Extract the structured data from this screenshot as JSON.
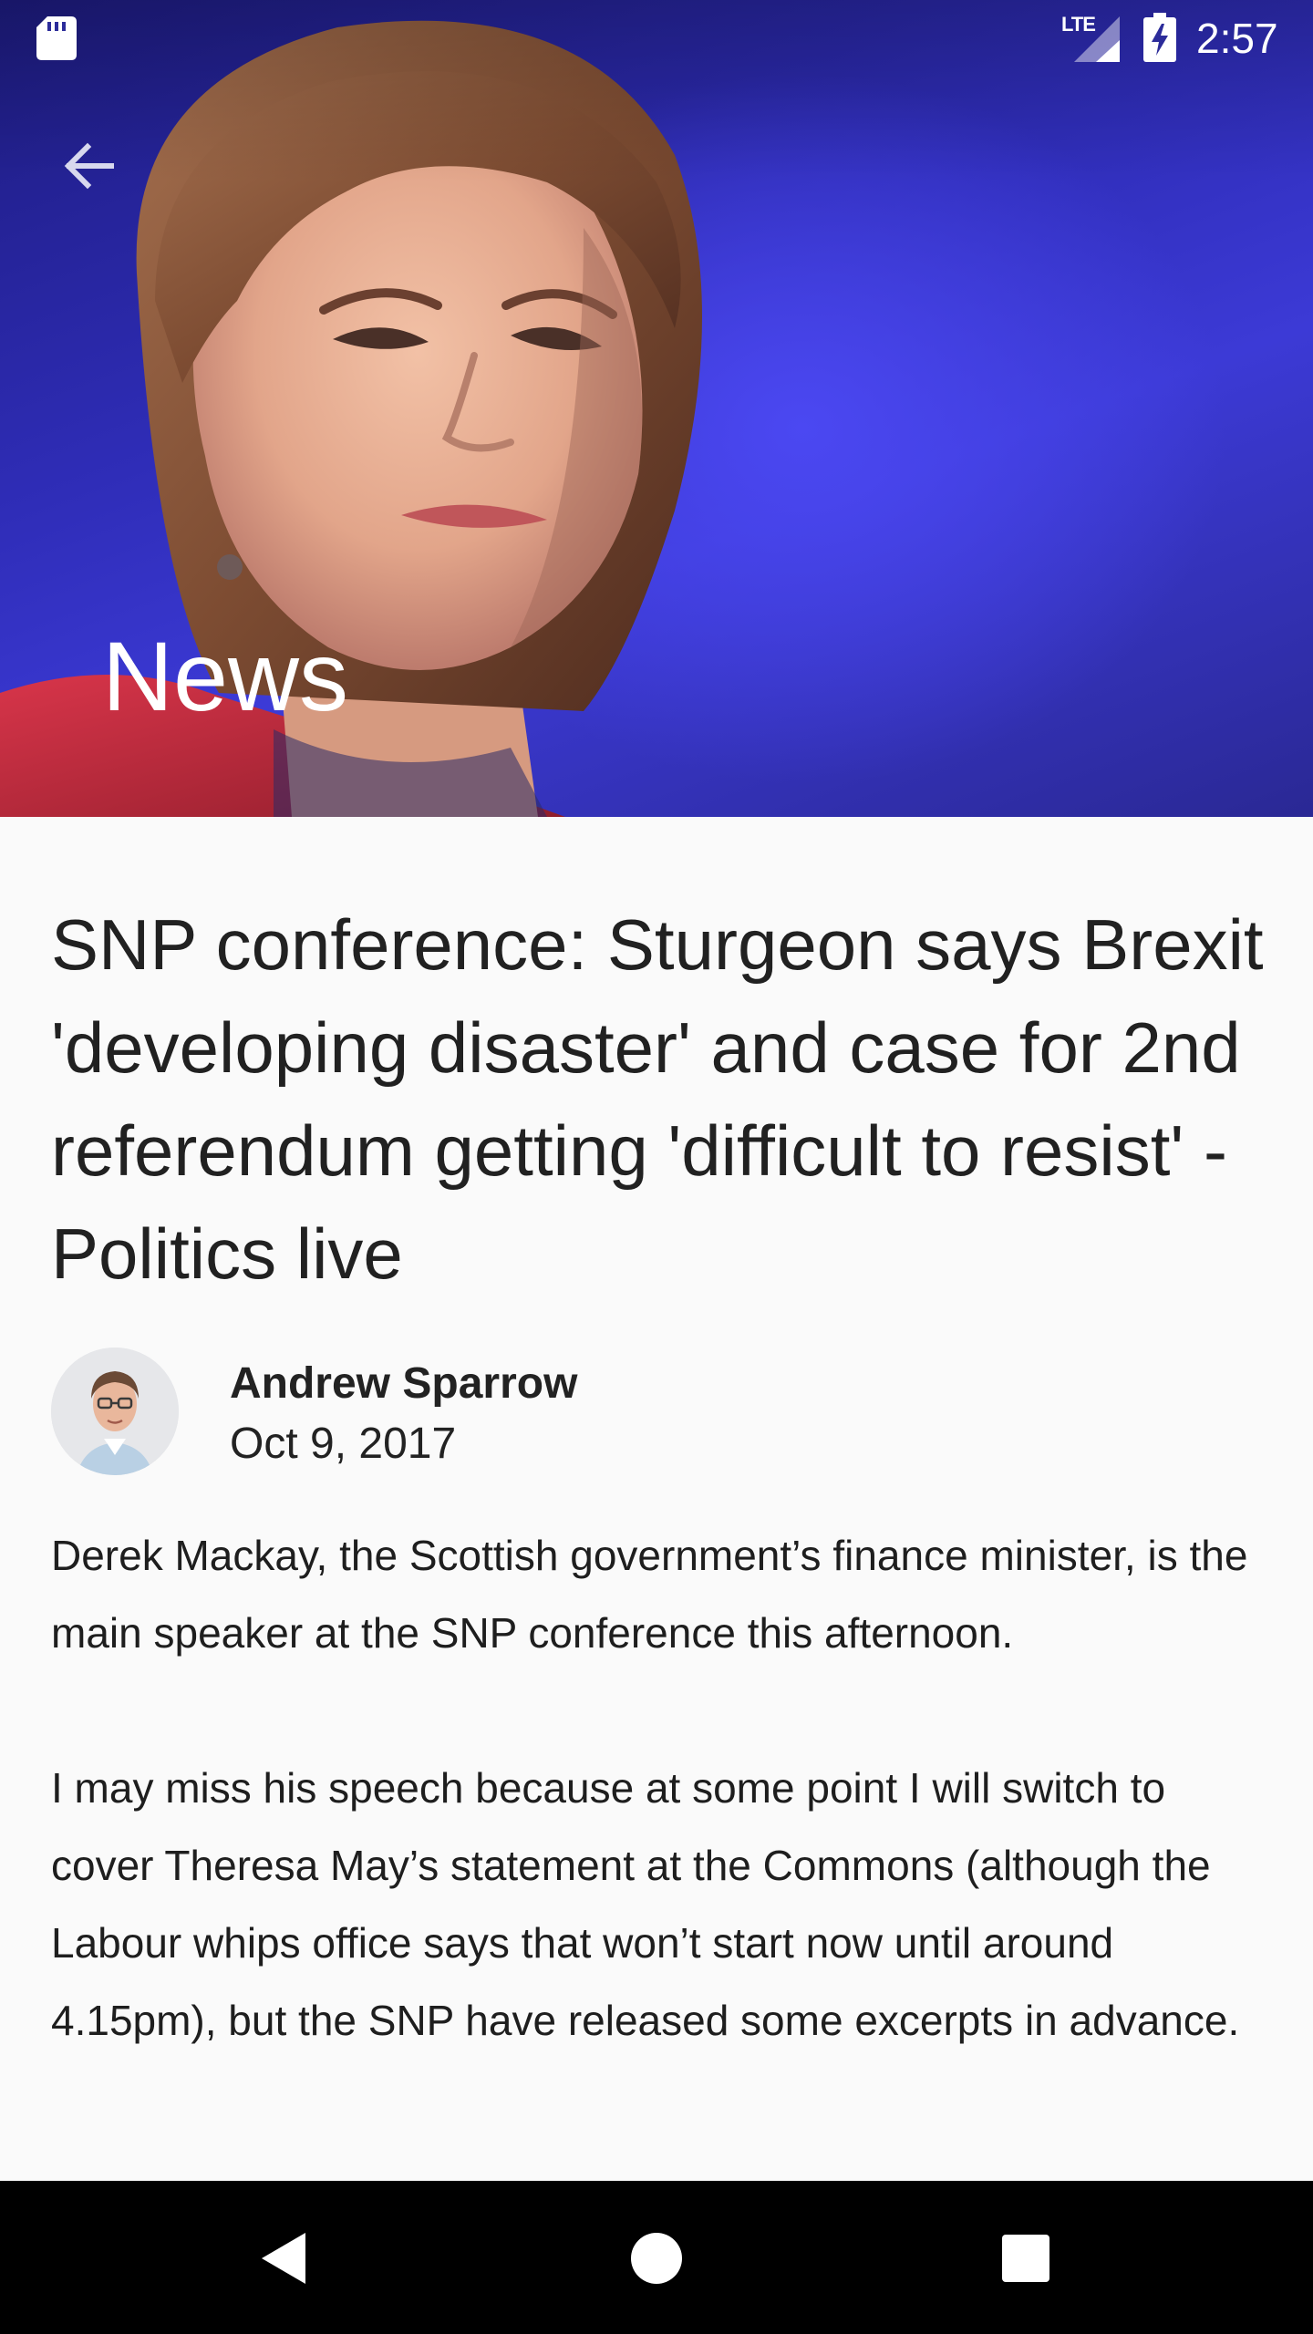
{
  "status_bar": {
    "network": "LTE",
    "time": "2:57"
  },
  "header": {
    "title": "News",
    "back_icon": "arrow-back-icon"
  },
  "article": {
    "headline": "SNP conference: Sturgeon says Brexit 'developing disaster' and case for 2nd referendum getting 'difficult to resist' - Politics live",
    "author": "Andrew Sparrow",
    "date": "Oct 9, 2017",
    "paragraphs": [
      "Derek Mackay, the Scottish government’s finance minister, is the main speaker at the SNP conference this afternoon.",
      "I may miss his speech because at some point I will switch to cover Theresa May’s statement at the Commons (although the Labour whips office says that won’t start now until around 4.15pm), but the SNP have released some excerpts in advance."
    ]
  },
  "nav_bar": {
    "back_icon": "nav-back-icon",
    "home_icon": "nav-home-icon",
    "recents_icon": "nav-recents-icon"
  },
  "colors": {
    "hero_blue": "#3c3ad6",
    "background": "#fafafa",
    "text": "#212121",
    "nav_bar": "#000000"
  }
}
